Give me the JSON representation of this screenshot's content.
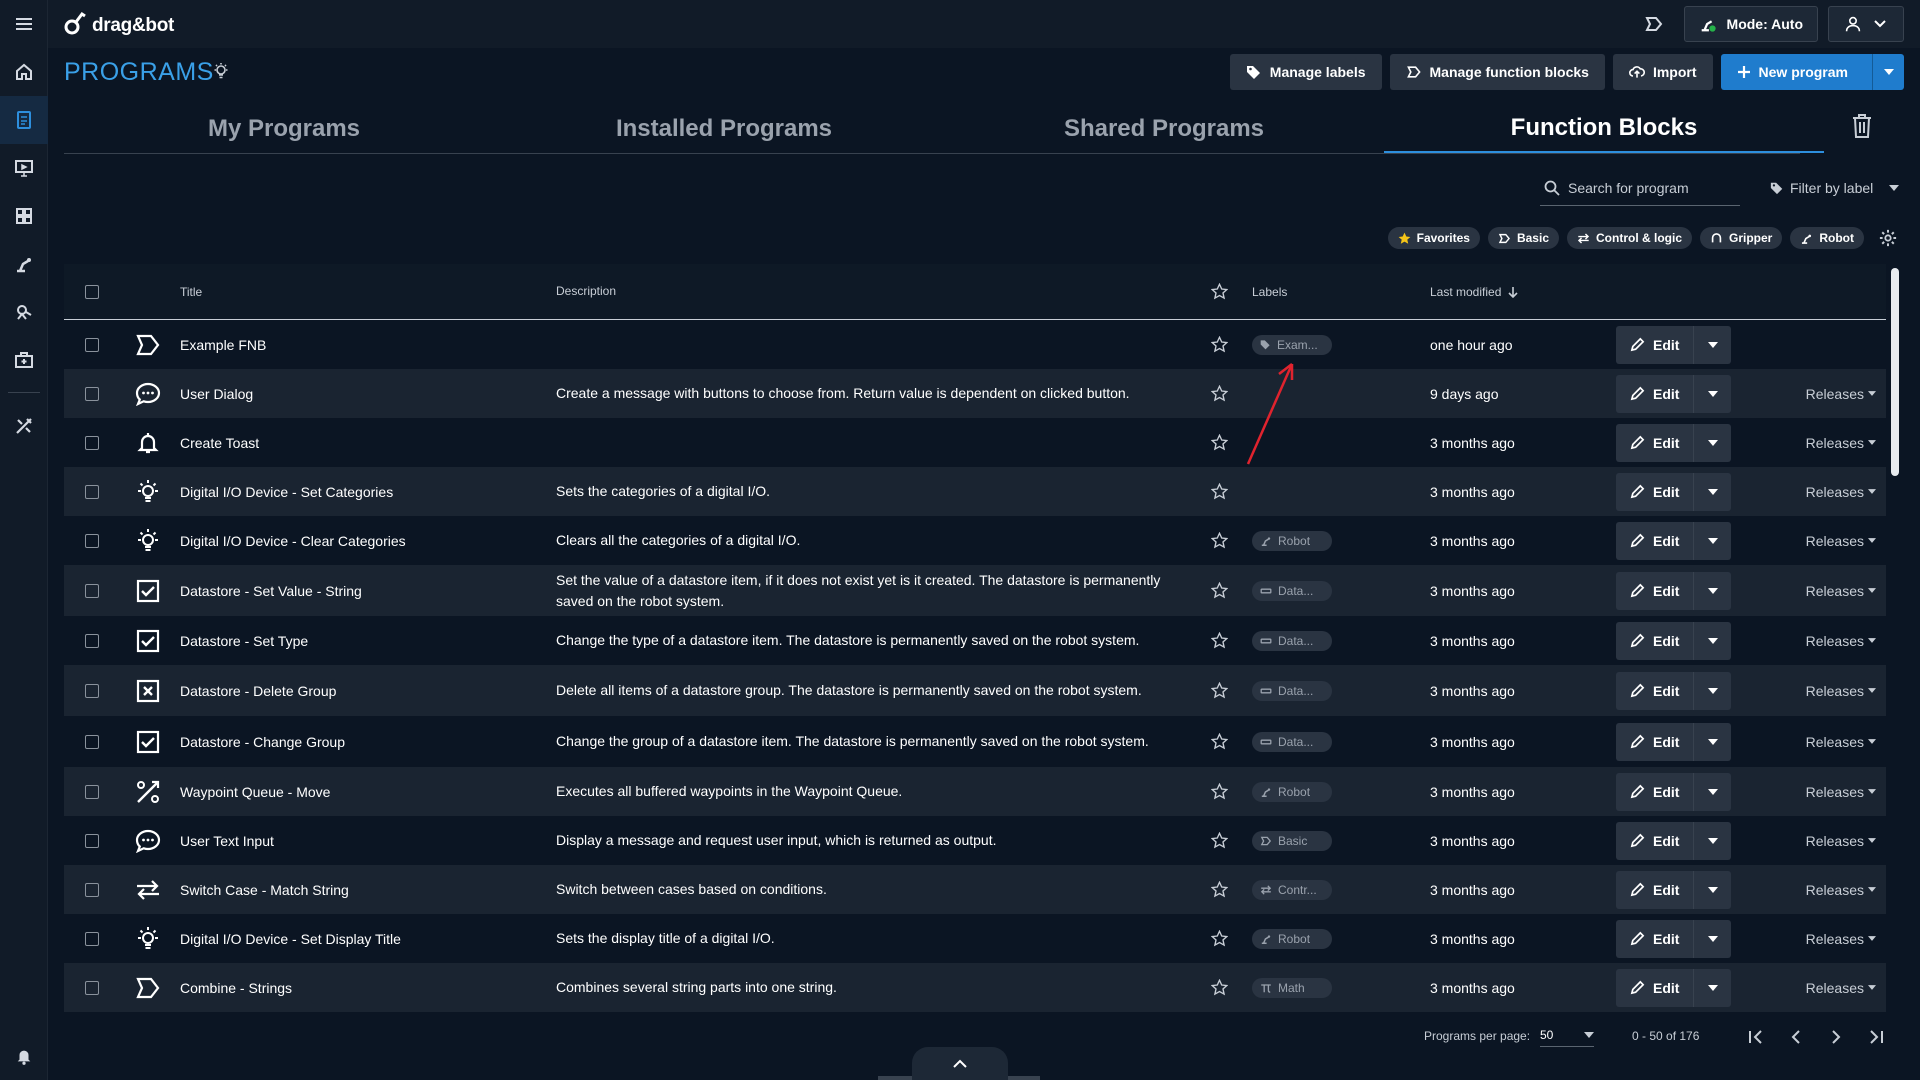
{
  "app": {
    "logo_text": "drag&bot"
  },
  "topbar": {
    "mode_label": "Mode: Auto"
  },
  "page": {
    "title": "PROGRAMS"
  },
  "actions": {
    "manage_labels": "Manage labels",
    "manage_function_blocks": "Manage function blocks",
    "import": "Import",
    "new_program": "New program"
  },
  "tabs": [
    "My Programs",
    "Installed Programs",
    "Shared Programs",
    "Function Blocks"
  ],
  "search": {
    "placeholder": "Search for program"
  },
  "filter": {
    "label": "Filter by label"
  },
  "chips": [
    "Favorites",
    "Basic",
    "Control & logic",
    "Gripper",
    "Robot"
  ],
  "table": {
    "headers": {
      "title": "Title",
      "description": "Description",
      "labels": "Labels",
      "last_modified": "Last modified"
    },
    "edit_label": "Edit",
    "releases_label": "Releases",
    "rows": [
      {
        "icon": "function-block-icon",
        "title": "Example FNB",
        "description": "",
        "label": "Exam...",
        "label_icon": "tag-icon",
        "modified": "one hour ago",
        "releases": false
      },
      {
        "icon": "chat-bubble-icon",
        "title": "User Dialog",
        "description": "Create a message with buttons to choose from. Return value is dependent on clicked button.",
        "label": "",
        "label_icon": "",
        "modified": "9 days ago",
        "releases": true
      },
      {
        "icon": "bell-icon",
        "title": "Create Toast",
        "description": "",
        "label": "",
        "label_icon": "",
        "modified": "3 months ago",
        "releases": true
      },
      {
        "icon": "lightbulb-icon",
        "title": "Digital I/O Device - Set Categories",
        "description": "Sets the categories of a digital I/O.",
        "label": "",
        "label_icon": "",
        "modified": "3 months ago",
        "releases": true
      },
      {
        "icon": "lightbulb-icon",
        "title": "Digital I/O Device - Clear Categories",
        "description": "Clears all the categories of a digital I/O.",
        "label": "Robot",
        "label_icon": "robot-arm-icon",
        "modified": "3 months ago",
        "releases": true
      },
      {
        "icon": "checkbox-icon",
        "title": "Datastore - Set Value - String",
        "description": "Set the value of a datastore item, if it does not exist yet is it created. The datastore is permanently saved on the robot system.",
        "label": "Data...",
        "label_icon": "datastore-icon",
        "modified": "3 months ago",
        "releases": true
      },
      {
        "icon": "checkbox-icon",
        "title": "Datastore - Set Type",
        "description": "Change the type of a datastore item. The datastore is permanently saved on the robot system.",
        "label": "Data...",
        "label_icon": "datastore-icon",
        "modified": "3 months ago",
        "releases": true
      },
      {
        "icon": "x-box-icon",
        "title": "Datastore - Delete Group",
        "description": "Delete all items of a datastore group. The datastore is permanently saved on the robot system.",
        "label": "Data...",
        "label_icon": "datastore-icon",
        "modified": "3 months ago",
        "releases": true
      },
      {
        "icon": "checkbox-icon",
        "title": "Datastore - Change Group",
        "description": "Change the group of a datastore item. The datastore is permanently saved on the robot system.",
        "label": "Data...",
        "label_icon": "datastore-icon",
        "modified": "3 months ago",
        "releases": true
      },
      {
        "icon": "waypoint-icon",
        "title": "Waypoint Queue - Move",
        "description": "Executes all buffered waypoints in the Waypoint Queue.",
        "label": "Robot",
        "label_icon": "robot-arm-icon",
        "modified": "3 months ago",
        "releases": true
      },
      {
        "icon": "chat-bubble-icon",
        "title": "User Text Input",
        "description": "Display a message and request user input, which is returned as output.",
        "label": "Basic",
        "label_icon": "function-block-icon",
        "modified": "3 months ago",
        "releases": true
      },
      {
        "icon": "switch-arrows-icon",
        "title": "Switch Case - Match String",
        "description": "Switch between cases based on conditions.",
        "label": "Contr...",
        "label_icon": "switch-arrows-icon",
        "modified": "3 months ago",
        "releases": true
      },
      {
        "icon": "lightbulb-icon",
        "title": "Digital I/O Device - Set Display Title",
        "description": "Sets the display title of a digital I/O.",
        "label": "Robot",
        "label_icon": "robot-arm-icon",
        "modified": "3 months ago",
        "releases": true
      },
      {
        "icon": "function-block-icon",
        "title": "Combine - Strings",
        "description": "Combines several string parts into one string.",
        "label": "Math",
        "label_icon": "pi-icon",
        "modified": "3 months ago",
        "releases": true
      }
    ]
  },
  "pagination": {
    "per_page_label": "Programs per page:",
    "per_page_value": "50",
    "range": "0 - 50 of 176"
  }
}
